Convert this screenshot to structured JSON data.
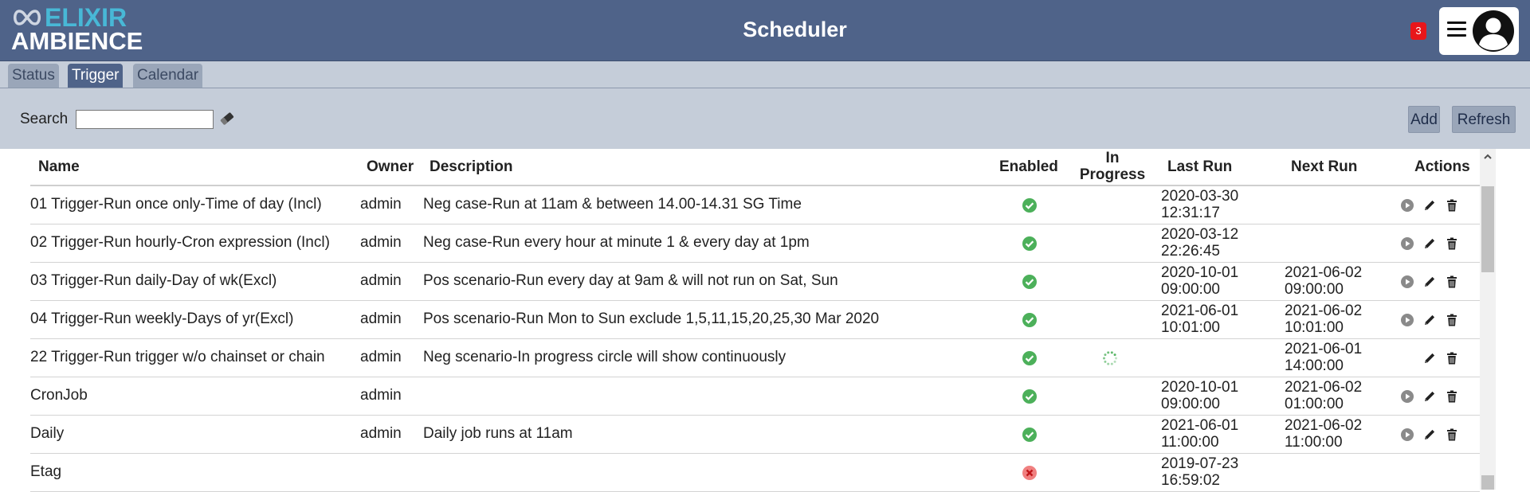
{
  "header": {
    "logo_top": "ELIXIR",
    "logo_bottom": "AMBIENCE",
    "title": "Scheduler",
    "notification_count": "3"
  },
  "tabs": [
    {
      "label": "Status"
    },
    {
      "label": "Trigger"
    },
    {
      "label": "Calendar"
    }
  ],
  "toolbar": {
    "search_label": "Search",
    "search_value": "",
    "search_placeholder": "",
    "add_label": "Add",
    "refresh_label": "Refresh"
  },
  "table": {
    "columns": {
      "name": "Name",
      "owner": "Owner",
      "description": "Description",
      "enabled": "Enabled",
      "in_progress_1": "In",
      "in_progress_2": "Progress",
      "last_run": "Last Run",
      "next_run": "Next Run",
      "actions": "Actions"
    },
    "rows": [
      {
        "name": "01 Trigger-Run once only-Time of day (Incl)",
        "owner": "admin",
        "description": "Neg case-Run at 11am & between 14.00-14.31 SG Time",
        "enabled": "ok",
        "in_progress": "",
        "last_run_date": "2020-03-30",
        "last_run_time": "12:31:17",
        "next_run_date": "",
        "next_run_time": "",
        "actions": [
          "run",
          "edit",
          "delete"
        ]
      },
      {
        "name": "02 Trigger-Run hourly-Cron expression (Incl)",
        "owner": "admin",
        "description": "Neg case-Run every hour at minute 1 & every day at 1pm",
        "enabled": "ok",
        "in_progress": "",
        "last_run_date": "2020-03-12",
        "last_run_time": "22:26:45",
        "next_run_date": "",
        "next_run_time": "",
        "actions": [
          "run",
          "edit",
          "delete"
        ]
      },
      {
        "name": "03 Trigger-Run daily-Day of wk(Excl)",
        "owner": "admin",
        "description": "Pos scenario-Run every day at 9am & will not run on Sat, Sun",
        "enabled": "ok",
        "in_progress": "",
        "last_run_date": "2020-10-01",
        "last_run_time": "09:00:00",
        "next_run_date": "2021-06-02",
        "next_run_time": "09:00:00",
        "actions": [
          "run",
          "edit",
          "delete"
        ]
      },
      {
        "name": "04 Trigger-Run weekly-Days of yr(Excl)",
        "owner": "admin",
        "description": "Pos scenario-Run Mon to Sun exclude 1,5,11,15,20,25,30 Mar 2020",
        "enabled": "ok",
        "in_progress": "",
        "last_run_date": "2021-06-01",
        "last_run_time": "10:01:00",
        "next_run_date": "2021-06-02",
        "next_run_time": "10:01:00",
        "actions": [
          "run",
          "edit",
          "delete"
        ]
      },
      {
        "name": "22 Trigger-Run trigger w/o chainset or chain",
        "owner": "admin",
        "description": "Neg scenario-In progress circle will show continuously",
        "enabled": "ok",
        "in_progress": "spinner",
        "last_run_date": "",
        "last_run_time": "",
        "next_run_date": "2021-06-01",
        "next_run_time": "14:00:00",
        "actions": [
          "edit",
          "delete"
        ]
      },
      {
        "name": "CronJob",
        "owner": "admin",
        "description": "",
        "enabled": "ok",
        "in_progress": "",
        "last_run_date": "2020-10-01",
        "last_run_time": "09:00:00",
        "next_run_date": "2021-06-02",
        "next_run_time": "01:00:00",
        "actions": [
          "run",
          "edit",
          "delete"
        ]
      },
      {
        "name": "Daily",
        "owner": "admin",
        "description": "Daily job runs at 11am",
        "enabled": "ok",
        "in_progress": "",
        "last_run_date": "2021-06-01",
        "last_run_time": "11:00:00",
        "next_run_date": "2021-06-02",
        "next_run_time": "11:00:00",
        "actions": [
          "run",
          "edit",
          "delete"
        ]
      },
      {
        "name": "Etag",
        "owner": "",
        "description": "",
        "enabled": "error",
        "in_progress": "",
        "last_run_date": "2019-07-23",
        "last_run_time": "16:59:02",
        "next_run_date": "",
        "next_run_time": "",
        "actions": []
      }
    ]
  },
  "icons": {
    "enabled": "check-circle-icon",
    "disabled": "x-circle-icon",
    "in_progress": "spinner-icon",
    "run": "play-icon",
    "edit": "pencil-icon",
    "delete": "trash-icon",
    "search_clear": "eraser-icon",
    "menu": "hamburger-menu-icon",
    "user": "user-avatar-icon"
  },
  "colors": {
    "header_bg": "#4f6389",
    "toolbar_bg": "#c5cdd9",
    "logo_accent": "#48b8d6",
    "enabled_green": "#4cb05a",
    "disabled_red": "#f08080",
    "badge_red": "#e8161a"
  }
}
